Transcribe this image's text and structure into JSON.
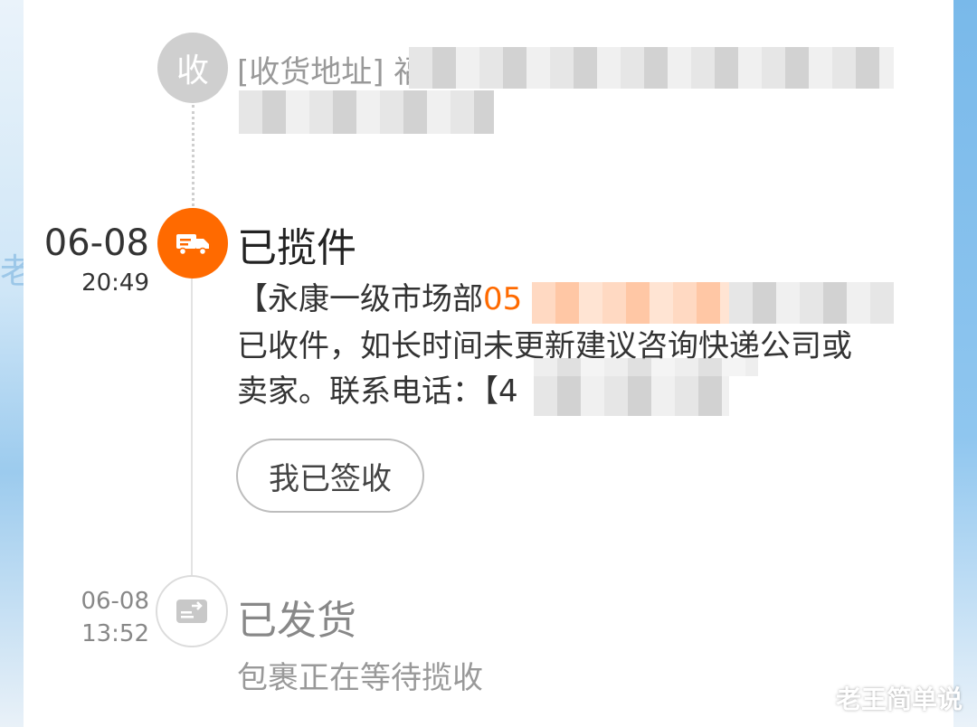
{
  "address": {
    "node_label": "收",
    "text": "[收货地址] 福"
  },
  "event_collected": {
    "date": "06-08",
    "time": "20:49",
    "status": "已揽件",
    "icon": "truck-icon",
    "desc_prefix": "【永康一级市场部",
    "desc_highlight": "05",
    "desc_line2": "已收件，如长时间未更新建议咨询快递公司或",
    "desc_line3": "卖家。联系电话：【4",
    "button_label": "我已签收"
  },
  "event_shipped": {
    "date": "06-08",
    "time": "13:52",
    "status": "已发货",
    "icon": "shipped-box-icon",
    "desc": "包裹正在等待揽收"
  },
  "watermark": "老王简单说",
  "colors": {
    "accent": "#ff6a00",
    "inactive": "#cfcfcf"
  }
}
